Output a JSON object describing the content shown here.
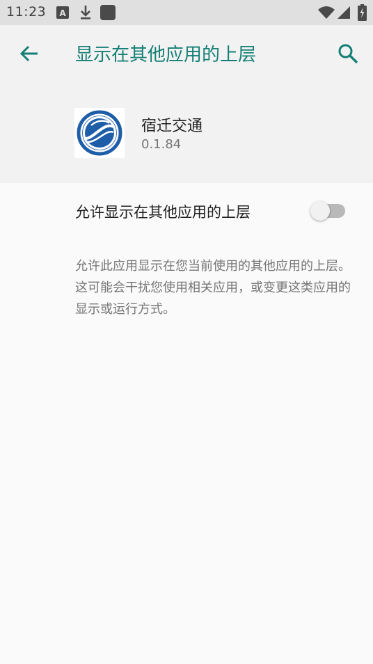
{
  "status_bar": {
    "time": "11:23",
    "left_icons": [
      "a-box-icon",
      "download-icon",
      "app-square-icon"
    ],
    "right_icons": [
      "wifi-icon",
      "cellular-icon",
      "battery-charging-icon"
    ]
  },
  "toolbar": {
    "title": "显示在其他应用的上层",
    "back_icon": "arrow-left-icon",
    "search_icon": "search-icon",
    "accent_color": "#137f74"
  },
  "app": {
    "name": "宿迁交通",
    "version": "0.1.84"
  },
  "setting": {
    "label": "允许显示在其他应用的上层",
    "enabled": false
  },
  "description": "允许此应用显示在您当前使用的其他应用的上层。这可能会干扰您使用相关应用，或变更这类应用的显示或运行方式。"
}
